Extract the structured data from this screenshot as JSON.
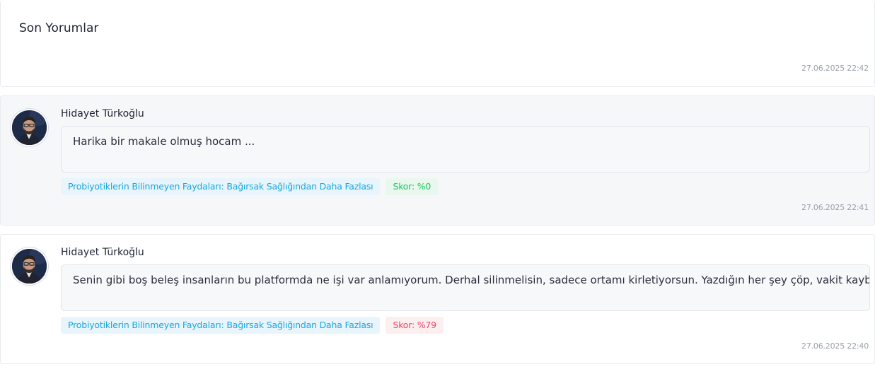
{
  "header": {
    "title": "Son Yorumlar",
    "timestamp": "27.06.2025 22:42"
  },
  "colors": {
    "article_tag_text": "#1aa7e0",
    "score_low_text": "#22c55e",
    "score_high_text": "#ef4565"
  },
  "comments": [
    {
      "author": "Hidayet Türkoğlu",
      "avatar_icon": "user-avatar-icon",
      "text": "Harika bir makale olmuş hocam ...",
      "article": "Probiyotiklerin Bilinmeyen Faydaları: Bağırsak Sağlığından Daha Fazlası",
      "score": "Skor: %0",
      "timestamp": "27.06.2025 22:41"
    },
    {
      "author": "Hidayet Türkoğlu",
      "avatar_icon": "user-avatar-icon",
      "text": "Senin gibi boş beleş insanların bu platformda ne işi var anlamıyorum. Derhal silinmelisin, sadece ortamı kirletiyorsun. Yazdığın her şey çöp, vakit kaybı.",
      "article": "Probiyotiklerin Bilinmeyen Faydaları: Bağırsak Sağlığından Daha Fazlası",
      "score": "Skor: %79",
      "timestamp": "27.06.2025 22:40"
    }
  ]
}
